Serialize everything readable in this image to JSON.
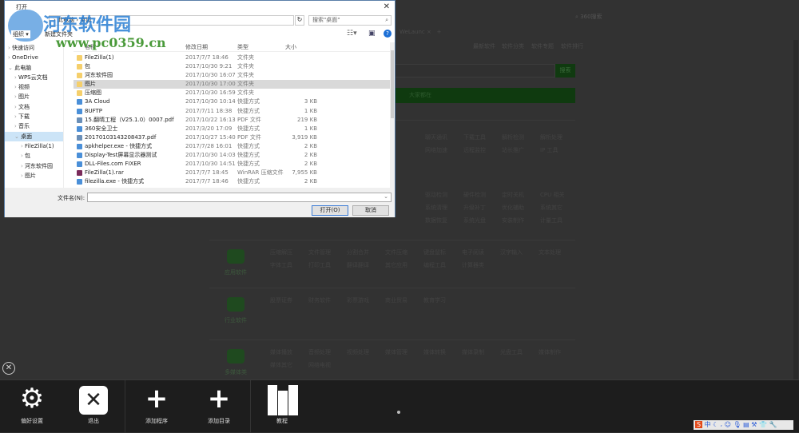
{
  "browser": {
    "address_search": "360搜索",
    "tab": "WeLaunc",
    "nav": [
      "最新软件",
      "软件分类",
      "软件专题",
      "软件排行"
    ],
    "search_button": "搜索",
    "green_banner": "大家都在",
    "rows": [
      [
        "聊天通讯",
        "下载工具",
        "解析检测",
        "解析处理"
      ],
      [
        "网络加速",
        "远程监控",
        "站长推广",
        "IP 工具"
      ],
      [
        "驱动检测",
        "硬件检测",
        "定时关机",
        "CPU 相关"
      ],
      [
        "系统清理",
        "升级补丁",
        "优化辅助",
        "系统其它"
      ],
      [
        "数据恢复",
        "系统光盘",
        "安装制作",
        "计量工具"
      ]
    ],
    "categories": [
      {
        "label": "应用软件",
        "items": [
          "压缩解压",
          "文件管理",
          "分割合并",
          "文件压缩",
          "键盘鼠标",
          "电子阅读",
          "汉字输入",
          "文本处理",
          "字体工具",
          "打印工具",
          "翻译翻译",
          "其它应用",
          "编程工具",
          "计算器类"
        ]
      },
      {
        "label": "行业软件",
        "items": [
          "股票证券",
          "财务软件",
          "彩票游戏",
          "商业贸易",
          "教育学习"
        ]
      },
      {
        "label": "多媒体类",
        "items": [
          "媒体播放",
          "音频处理",
          "视频处理",
          "媒体管理",
          "媒体转换",
          "媒体录制",
          "光盘工具",
          "媒体制作",
          "媒体其它",
          "网络电视"
        ]
      }
    ]
  },
  "dialog": {
    "title": "打开",
    "breadcrumb": [
      "此电脑",
      "桌面"
    ],
    "search_placeholder": "搜索\"桌面\"",
    "organize": "组织 ▾",
    "new_folder": "新建文件夹",
    "sidebar": [
      "快速访问",
      "OneDrive",
      "此电脑",
      "WPS云文档",
      "视频",
      "图片",
      "文档",
      "下载",
      "音乐",
      "桌面",
      "FileZilla(1)",
      "包",
      "河东软件园",
      "图片"
    ],
    "columns": [
      "名称",
      "修改日期",
      "类型",
      "大小"
    ],
    "files": [
      {
        "name": "FileZilla(1)",
        "date": "2017/7/7 18:46",
        "type": "文件夹",
        "size": "",
        "icon": "folder"
      },
      {
        "name": "包",
        "date": "2017/10/30 9:21",
        "type": "文件夹",
        "size": "",
        "icon": "folder"
      },
      {
        "name": "河东软件园",
        "date": "2017/10/30 16:07",
        "type": "文件夹",
        "size": "",
        "icon": "folder"
      },
      {
        "name": "图片",
        "date": "2017/10/30 17:00",
        "type": "文件夹",
        "size": "",
        "icon": "folder"
      },
      {
        "name": "压缩图",
        "date": "2017/10/30 16:59",
        "type": "文件夹",
        "size": "",
        "icon": "folder"
      },
      {
        "name": "3A Cloud",
        "date": "2017/10/30 10:14",
        "type": "快捷方式",
        "size": "3 KB",
        "icon": "shortcut"
      },
      {
        "name": "8UFTP",
        "date": "2017/7/11 18:38",
        "type": "快捷方式",
        "size": "1 KB",
        "icon": "shortcut"
      },
      {
        "name": "15.翻晴工程（V25.1.0）0007.pdf",
        "date": "2017/10/22 16:13",
        "type": "PDF 文件",
        "size": "219 KB",
        "icon": "pdf"
      },
      {
        "name": "360安全卫士",
        "date": "2017/3/20 17:09",
        "type": "快捷方式",
        "size": "1 KB",
        "icon": "shortcut"
      },
      {
        "name": "20170103143208437.pdf",
        "date": "2017/10/27 15:40",
        "type": "PDF 文件",
        "size": "3,919 KB",
        "icon": "pdf"
      },
      {
        "name": "apkhelper.exe - 快捷方式",
        "date": "2017/7/28 16:01",
        "type": "快捷方式",
        "size": "2 KB",
        "icon": "shortcut"
      },
      {
        "name": "Display-Test屏幕显示器测试",
        "date": "2017/10/30 14:03",
        "type": "快捷方式",
        "size": "2 KB",
        "icon": "shortcut"
      },
      {
        "name": "DLL-Files.com FIXER",
        "date": "2017/10/30 14:51",
        "type": "快捷方式",
        "size": "2 KB",
        "icon": "shortcut"
      },
      {
        "name": "FileZilla(1).rar",
        "date": "2017/7/7 18:45",
        "type": "WinRAR 压缩文件",
        "size": "7,955 KB",
        "icon": "rar"
      },
      {
        "name": "filezilla.exe - 快捷方式",
        "date": "2017/7/7 18:46",
        "type": "快捷方式",
        "size": "2 KB",
        "icon": "shortcut"
      }
    ],
    "filename_label": "文件名(N):",
    "filename_value": "",
    "open_button": "打开(O)",
    "cancel_button": "取消"
  },
  "watermark": {
    "name": "河东软件园",
    "url": "www.pc0359.cn"
  },
  "bottombar": {
    "items": [
      "偏好设置",
      "退出",
      "添加程序",
      "添加目录",
      "教程"
    ]
  },
  "tray": {
    "ime": "中"
  }
}
